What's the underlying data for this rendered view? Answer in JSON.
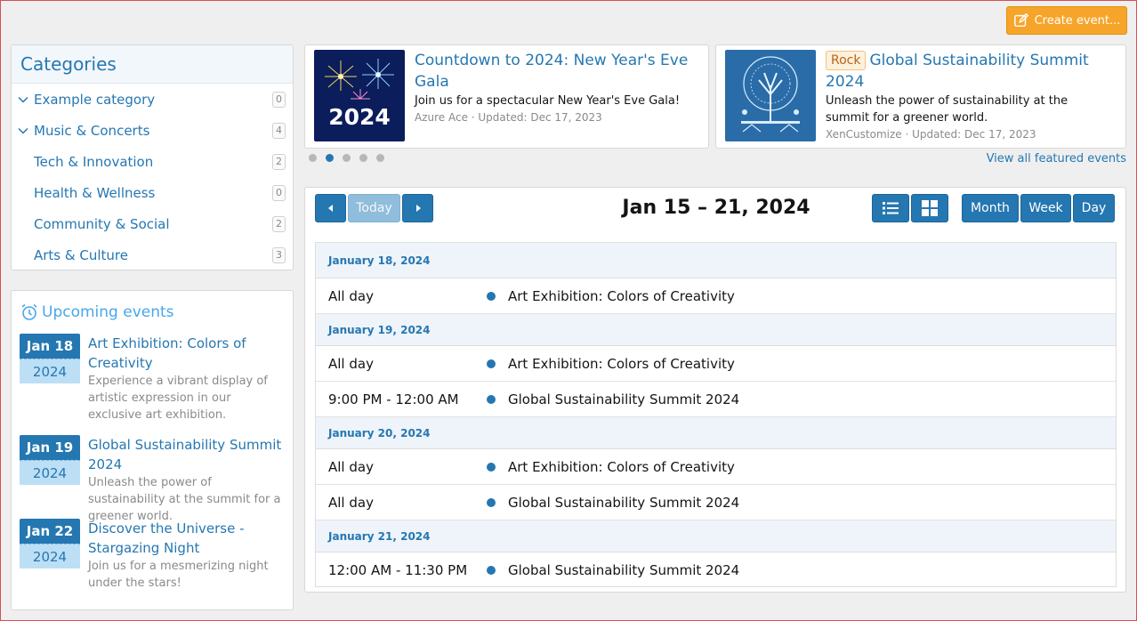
{
  "header": {
    "create_event_label": "Create event..."
  },
  "categories": {
    "title": "Categories",
    "items": [
      {
        "label": "Example category",
        "count": "0",
        "expandable": true
      },
      {
        "label": "Music & Concerts",
        "count": "4",
        "expandable": true
      },
      {
        "label": "Tech & Innovation",
        "count": "2",
        "expandable": false
      },
      {
        "label": "Health & Wellness",
        "count": "0",
        "expandable": false
      },
      {
        "label": "Community & Social",
        "count": "2",
        "expandable": false
      },
      {
        "label": "Arts & Culture",
        "count": "3",
        "expandable": false
      }
    ]
  },
  "upcoming": {
    "title": "Upcoming events",
    "items": [
      {
        "date": "Jan 18",
        "year": "2024",
        "title": "Art Exhibition: Colors of Creativity",
        "description": "Experience a vibrant display of artistic expression in our exclusive art exhibition."
      },
      {
        "date": "Jan 19",
        "year": "2024",
        "title": "Global Sustainability Summit 2024",
        "description": "Unleash the power of sustainability at the summit for a greener world."
      },
      {
        "date": "Jan 22",
        "year": "2024",
        "title": "Discover the Universe - Stargazing Night",
        "description": "Join us for a mesmerizing night under the stars!"
      }
    ]
  },
  "featured": {
    "cards": [
      {
        "thumb_text": "2024",
        "title": "Countdown to 2024: New Year's Eve Gala",
        "description": "Join us for a spectacular New Year's Eve Gala!",
        "meta": "Azure Ace · Updated: Dec 17, 2023"
      },
      {
        "badge": "Rock",
        "title": "Global Sustainability Summit 2024",
        "description": "Unleash the power of sustainability at the summit for a greener world.",
        "meta": "XenCustomize · Updated: Dec 17, 2023"
      }
    ],
    "dot_count": 5,
    "active_dot": 1,
    "view_all_label": "View all featured events"
  },
  "calendar": {
    "today_label": "Today",
    "title": "Jan 15 – 21, 2024",
    "view_buttons": {
      "month": "Month",
      "week": "Week",
      "day": "Day"
    },
    "days": [
      {
        "label": "January 18, 2024",
        "events": [
          {
            "time": "All day",
            "title": "Art Exhibition: Colors of Creativity"
          }
        ]
      },
      {
        "label": "January 19, 2024",
        "events": [
          {
            "time": "All day",
            "title": "Art Exhibition: Colors of Creativity"
          },
          {
            "time": "9:00 PM - 12:00 AM",
            "title": "Global Sustainability Summit 2024"
          }
        ]
      },
      {
        "label": "January 20, 2024",
        "events": [
          {
            "time": "All day",
            "title": "Art Exhibition: Colors of Creativity"
          },
          {
            "time": "All day",
            "title": "Global Sustainability Summit 2024"
          }
        ]
      },
      {
        "label": "January 21, 2024",
        "events": [
          {
            "time": "12:00 AM - 11:30 PM",
            "title": "Global Sustainability Summit 2024"
          }
        ]
      }
    ]
  },
  "colors": {
    "accent": "#2577b1",
    "create_button": "#f7a52a",
    "badge_bg": "#fdf1dc"
  }
}
